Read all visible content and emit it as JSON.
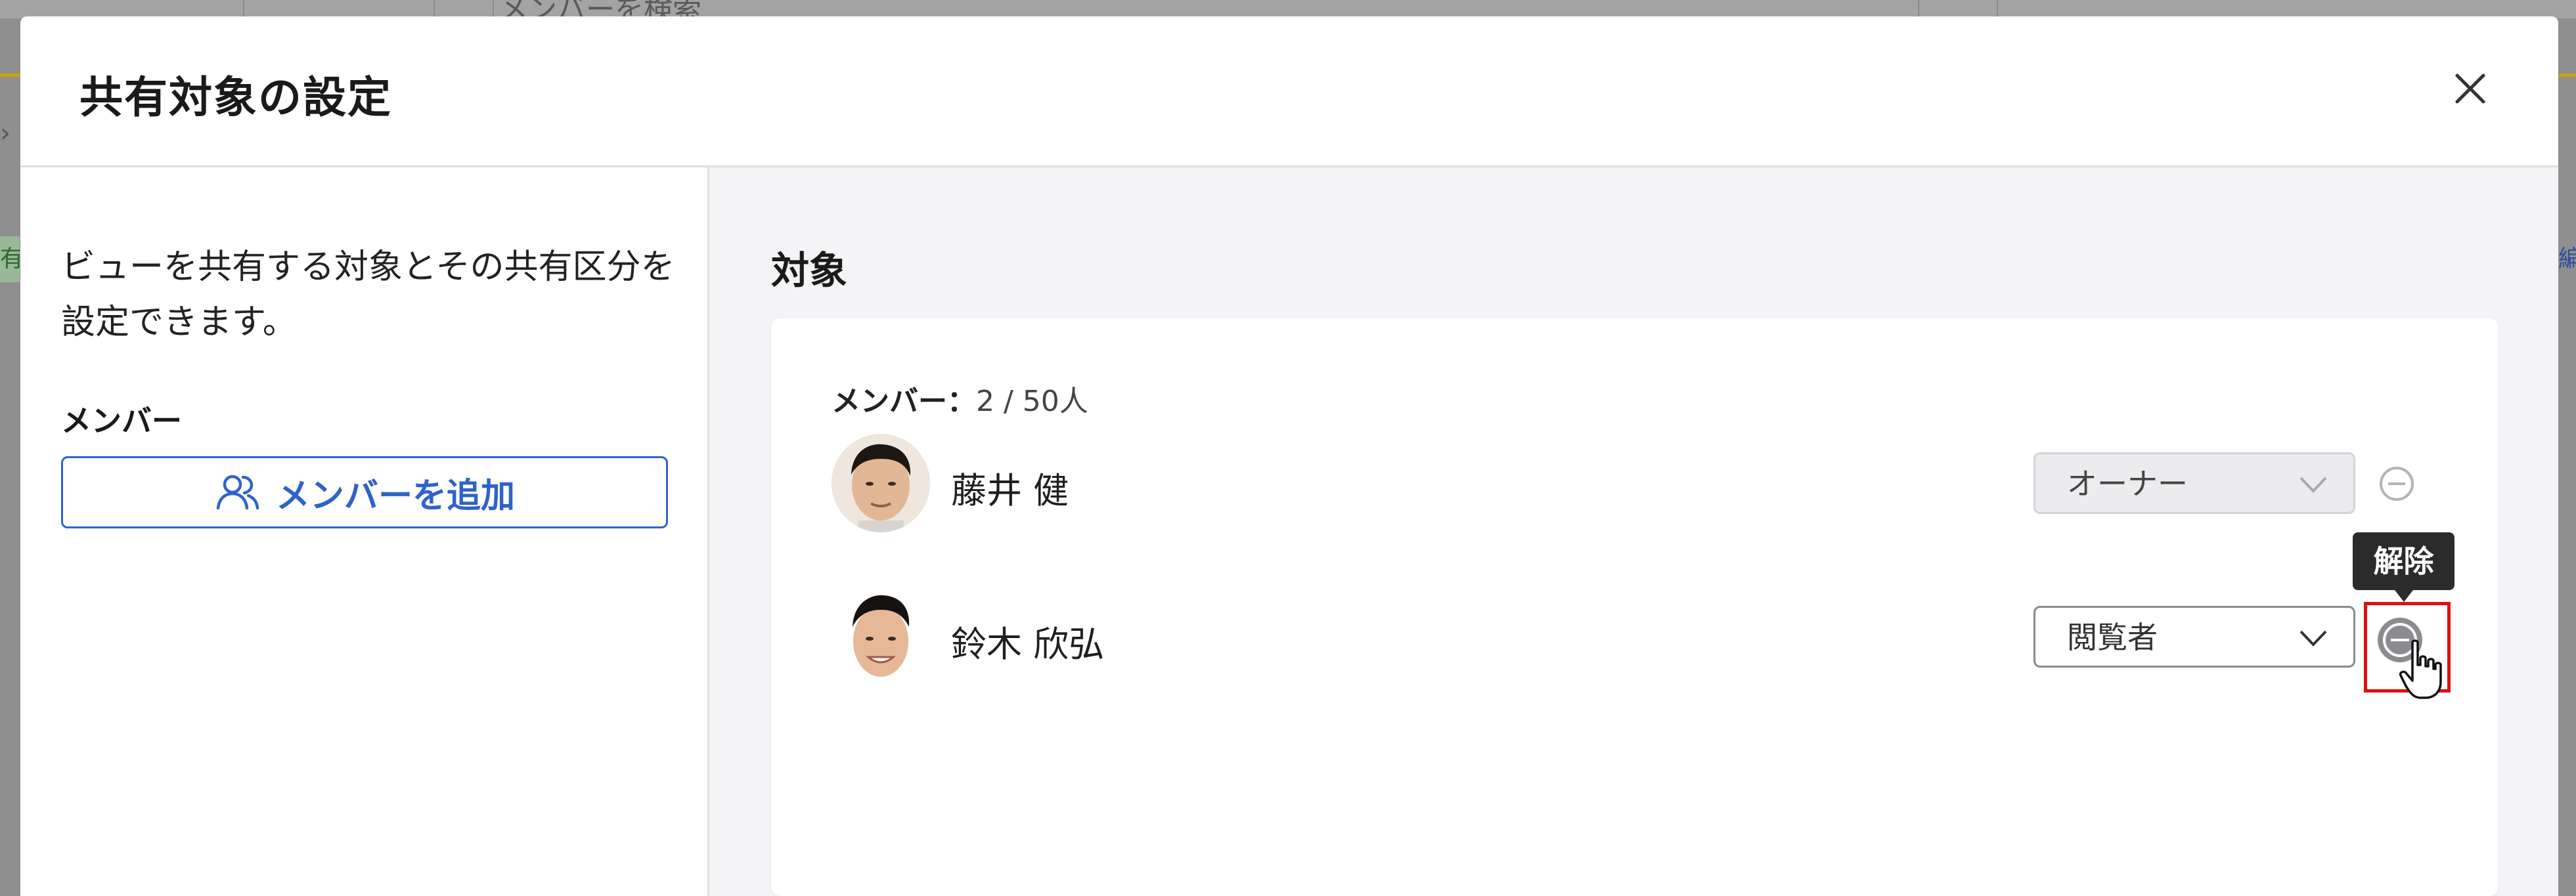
{
  "background": {
    "search_placeholder": "メンバーを検索",
    "left_fragment": "有",
    "right_fragment": "編"
  },
  "modal": {
    "title": "共有対象の設定",
    "close_icon": "close-icon"
  },
  "left_pane": {
    "description": "ビューを共有する対象とその共有区分を設定できます。",
    "member_heading": "メンバー",
    "add_member_button": "メンバーを追加"
  },
  "right_pane": {
    "title": "対象",
    "member_count_label": "メンバー：",
    "member_count_value": "2 / 50人",
    "members": [
      {
        "name": "藤井 健",
        "role": "オーナー",
        "role_enabled": false
      },
      {
        "name": "鈴木 欣弘",
        "role": "閲覧者",
        "role_enabled": true
      }
    ],
    "tooltip": "解除"
  },
  "colors": {
    "accent": "#2f63c8",
    "highlight": "#e01010"
  }
}
